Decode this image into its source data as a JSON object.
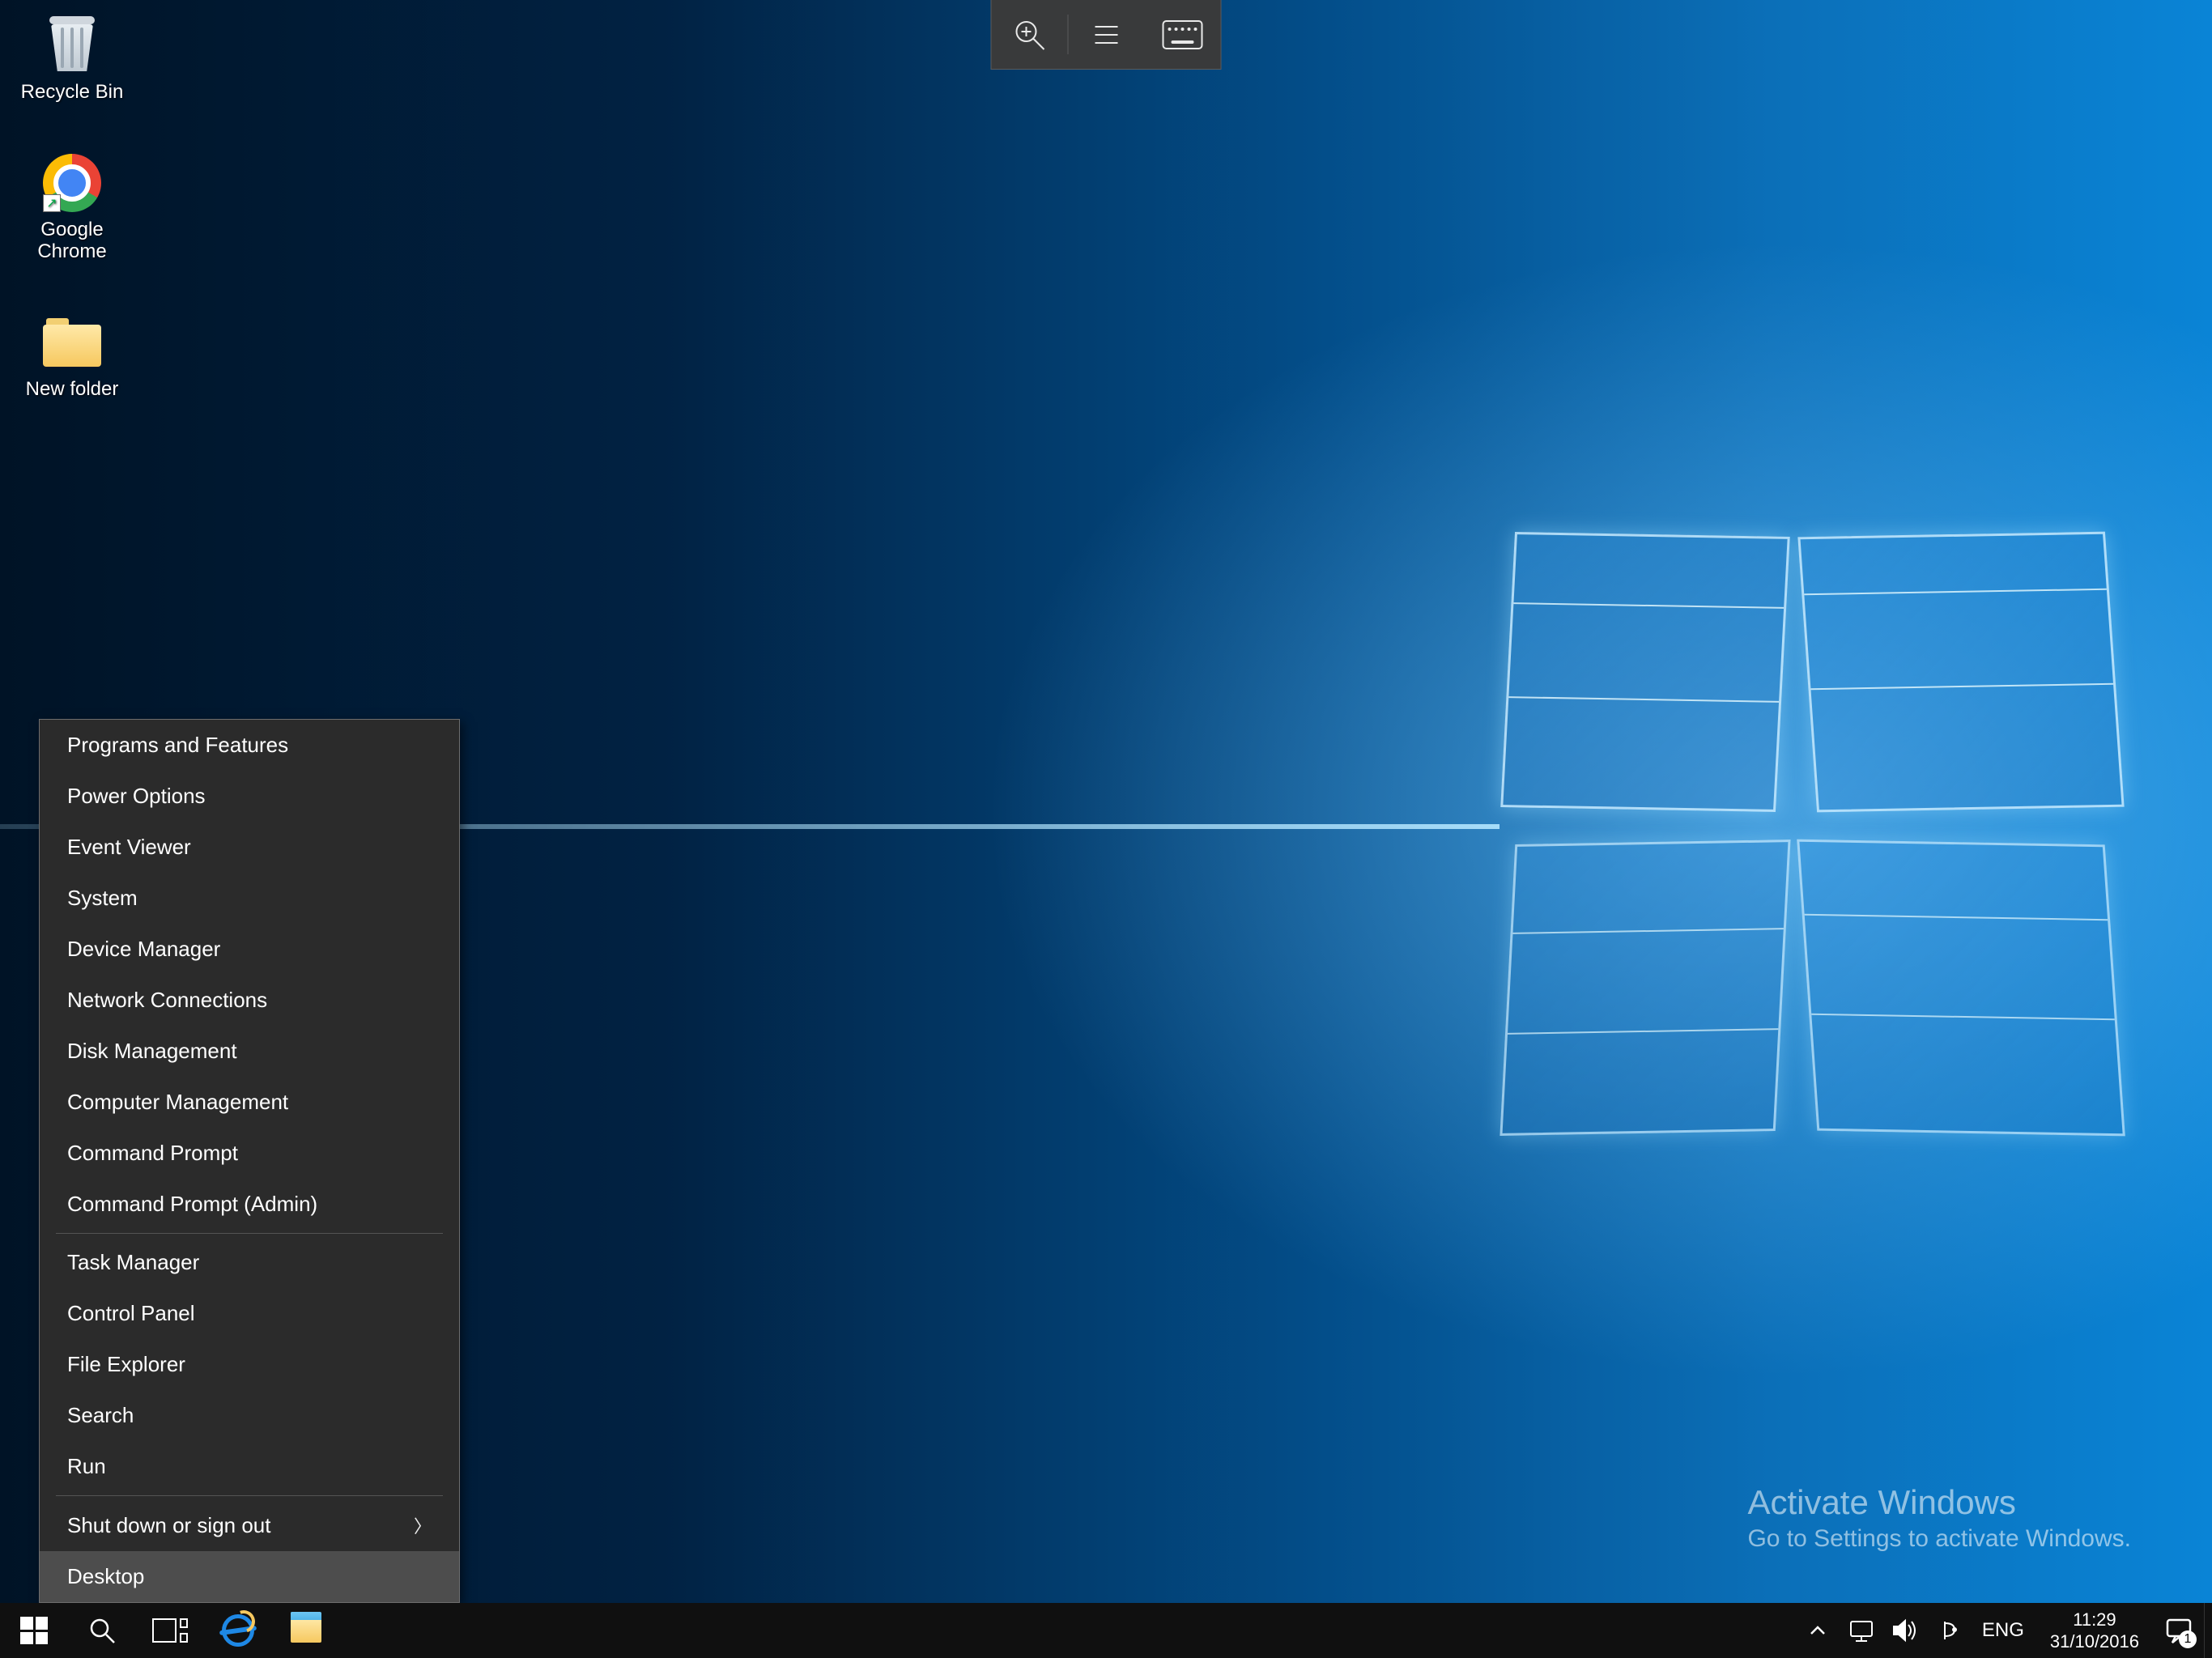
{
  "desktop_icons": [
    {
      "id": "recycle-bin",
      "label": "Recycle Bin"
    },
    {
      "id": "google-chrome",
      "label": "Google\nChrome"
    },
    {
      "id": "new-folder",
      "label": "New folder"
    }
  ],
  "top_toolbar": {
    "buttons": [
      "zoom-in",
      "menu",
      "keyboard"
    ]
  },
  "winx_menu": {
    "group1": [
      "Programs and Features",
      "Power Options",
      "Event Viewer",
      "System",
      "Device Manager",
      "Network Connections",
      "Disk Management",
      "Computer Management",
      "Command Prompt",
      "Command Prompt (Admin)"
    ],
    "group2": [
      "Task Manager",
      "Control Panel",
      "File Explorer",
      "Search",
      "Run"
    ],
    "group3_submenu": "Shut down or sign out",
    "group3_last": "Desktop"
  },
  "watermark": {
    "title": "Activate Windows",
    "subtitle": "Go to Settings to activate Windows."
  },
  "taskbar": {
    "buttons": [
      "start",
      "search",
      "task-view",
      "internet-explorer",
      "file-explorer"
    ],
    "tray": {
      "language_code": "ENG",
      "time": "11:29",
      "date": "31/10/2016",
      "notification_count": "1"
    }
  }
}
